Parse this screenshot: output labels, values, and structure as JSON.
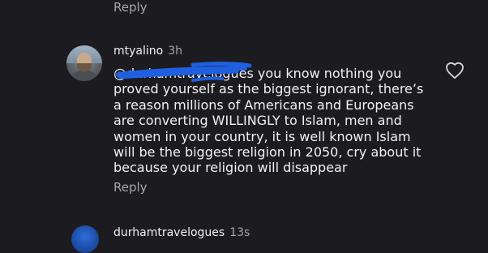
{
  "previous_comment": {
    "reply_label": "Reply"
  },
  "comment": {
    "username": "mtyalino",
    "time": "3h",
    "mention": "@durhamtravelogues",
    "text": " you know nothing you proved yourself as the biggest ignorant, there’s a reason millions of Americans and Europeans are converting WILLINGLY to Islam, men and women in your country, it is well known Islam will be the biggest religion in 2050, cry about it because your religion will disappear",
    "reply_label": "Reply",
    "like_icon": "heart-outline-icon"
  },
  "next_comment": {
    "username": "durhamtravelogues",
    "time": "13s"
  },
  "colors": {
    "background": "#1c1b1f",
    "primary_text": "#f2f2f2",
    "secondary_text": "#a7a7ab",
    "scribble": "#1f5fe0"
  }
}
